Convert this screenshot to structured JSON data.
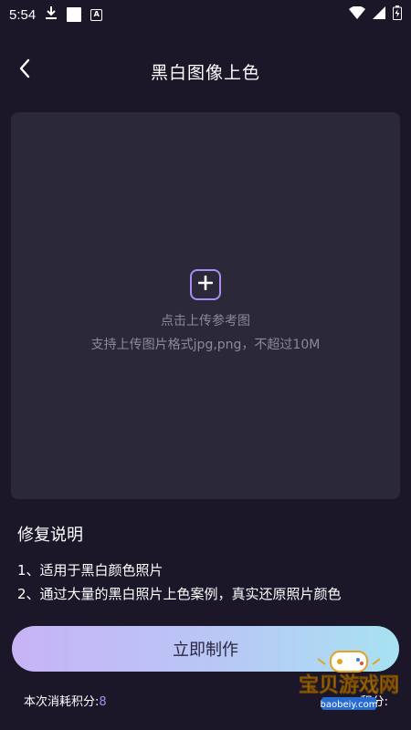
{
  "status_bar": {
    "time": "5:54"
  },
  "header": {
    "title": "黑白图像上色"
  },
  "upload": {
    "title": "点击上传参考图",
    "hint": "支持上传图片格式jpg,png，不超过10M"
  },
  "notes": {
    "title": "修复说明",
    "items": [
      "1、适用于黑白颜色照片",
      "2、通过大量的黑白照片上色案例，真实还原照片颜色"
    ]
  },
  "action": {
    "make_label": "立即制作"
  },
  "footer": {
    "cost_label": "本次消耗积分:",
    "cost_value": "8",
    "balance_label": "积分:"
  },
  "watermark": {
    "text": "宝贝游戏网",
    "url": "baobeiy.com"
  },
  "colors": {
    "background": "#1b1728",
    "panel": "#2a2839",
    "accent": "#a88ef3"
  }
}
